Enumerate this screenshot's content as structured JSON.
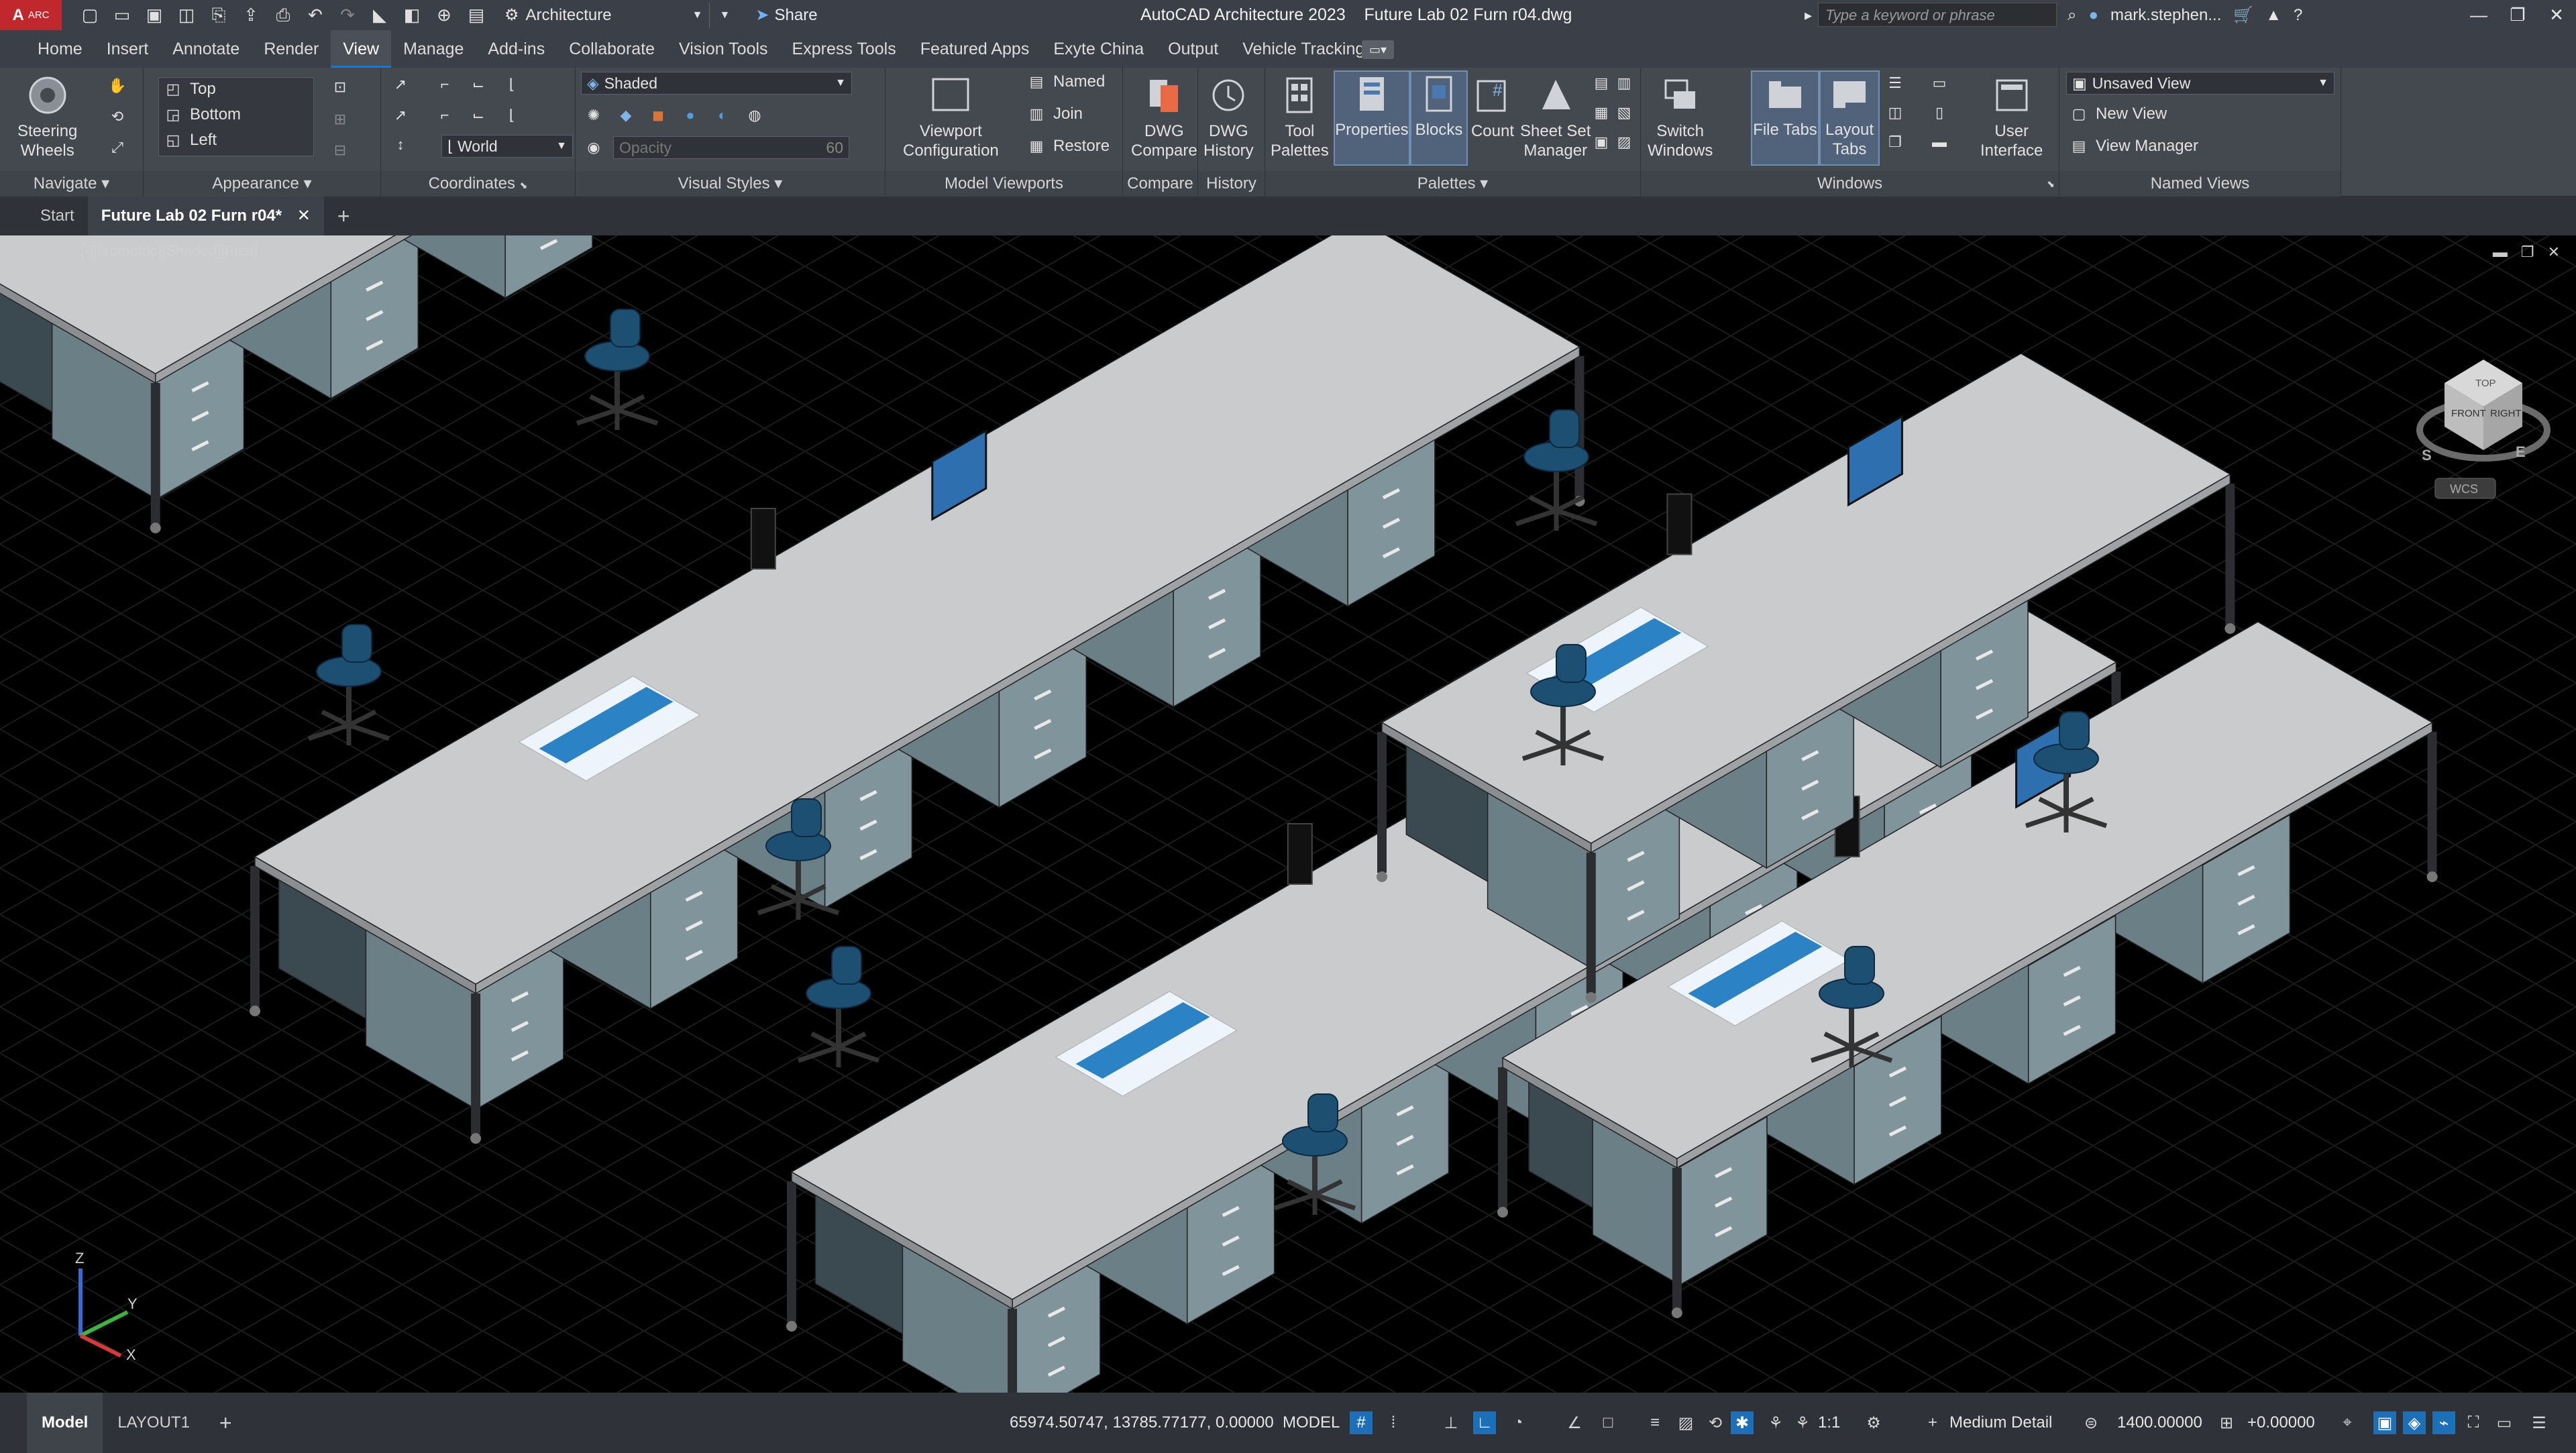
{
  "titlebar": {
    "logo_letter": "A",
    "logo_text": "ARC",
    "workspace": "Architecture",
    "share_label": "Share",
    "app_title": "AutoCAD Architecture 2023",
    "file_title": "Future Lab 02 Furn r04.dwg",
    "search_placeholder": "Type a keyword or phrase",
    "user": "mark.stephen..."
  },
  "menu_tabs": [
    "Home",
    "Insert",
    "Annotate",
    "Render",
    "View",
    "Manage",
    "Add-ins",
    "Collaborate",
    "Vision Tools",
    "Express Tools",
    "Featured Apps",
    "Exyte China",
    "Output",
    "Vehicle Tracking"
  ],
  "active_tab": "View",
  "ribbon": {
    "navigate": {
      "title": "Navigate",
      "steering_line1": "Steering",
      "steering_line2": "Wheels"
    },
    "appearance": {
      "title": "Appearance",
      "views": [
        "Top",
        "Bottom",
        "Left"
      ]
    },
    "coordinates": {
      "title": "Coordinates",
      "ucs": "World"
    },
    "visual_styles": {
      "title": "Visual Styles",
      "style": "Shaded",
      "opacity_label": "Opacity",
      "opacity_value": "60"
    },
    "model_viewports": {
      "title": "Model Viewports",
      "config_line1": "Viewport",
      "config_line2": "Configuration",
      "named": "Named",
      "join": "Join",
      "restore": "Restore"
    },
    "compare": {
      "title": "Compare",
      "line1": "DWG",
      "line2": "Compare"
    },
    "history": {
      "title": "History",
      "line1": "DWG",
      "line2": "History"
    },
    "palettes": {
      "title": "Palettes",
      "tool_line1": "Tool",
      "tool_line2": "Palettes",
      "properties": "Properties",
      "blocks": "Blocks",
      "count": "Count",
      "ssm_line1": "Sheet Set",
      "ssm_line2": "Manager"
    },
    "windows": {
      "title": "Windows",
      "switch_line1": "Switch",
      "switch_line2": "Windows",
      "file_tabs": "File Tabs",
      "layout_line1": "Layout",
      "layout_line2": "Tabs",
      "ui_line1": "User",
      "ui_line2": "Interface"
    },
    "named_views": {
      "title": "Named Views",
      "current": "Unsaved View",
      "new_view": "New View",
      "view_manager": "View Manager"
    }
  },
  "doc_tabs": {
    "start": "Start",
    "active": "Future Lab 02 Furn r04*",
    "new_tab": "+"
  },
  "viewport": {
    "label": "[-][Isometric][Shaded][Fast]",
    "viewcube": {
      "top": "TOP",
      "front": "FRONT",
      "right": "RIGHT",
      "south": "S",
      "east": "E",
      "ucs": "WCS"
    },
    "ucs_icon": {
      "x": "X",
      "y": "Y",
      "z": "Z"
    }
  },
  "statusbar": {
    "model_tab": "Model",
    "layout_tab": "LAYOUT1",
    "add": "+",
    "coordinates": "65974.50747, 13785.77177, 0.00000",
    "space": "MODEL",
    "scale": "1:1",
    "detail": "Medium Detail",
    "elevation": "1400.00000",
    "offset": "+0.00000"
  },
  "colors": {
    "accent": "#0e79d6",
    "logo": "#c0282d",
    "bench_top": "#c9cbcd",
    "cabinet": "#7f949b",
    "frame": "#2b2d30",
    "chair": "#1d4f73",
    "tote": "#4fb0a8",
    "monitor_screen": "#2e6fb0"
  }
}
